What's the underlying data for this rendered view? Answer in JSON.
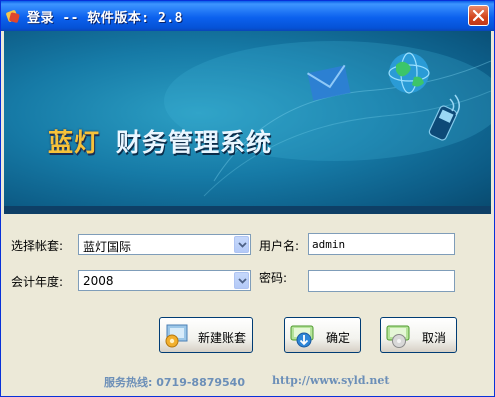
{
  "window": {
    "title": "登录 -- 软件版本: 2.8"
  },
  "banner": {
    "brand": "蓝灯",
    "system_name": "财务管理系统"
  },
  "form": {
    "account_label": "选择帐套:",
    "account_value": "蓝灯国际",
    "year_label": "会计年度:",
    "year_value": "2008",
    "username_label": "用户名:",
    "username_value": "admin",
    "password_label": "密码:",
    "password_value": ""
  },
  "buttons": {
    "new_account": "新建账套",
    "ok": "确定",
    "cancel": "取消"
  },
  "footer": {
    "hotline": "服务热线: 0719-8879540",
    "url": "http://www.syld.net"
  },
  "colors": {
    "title_bar": "#0A5FE8",
    "banner": "#167AA6",
    "brand_text": "#F6C23A",
    "footer_text": "#6C8FB8"
  }
}
